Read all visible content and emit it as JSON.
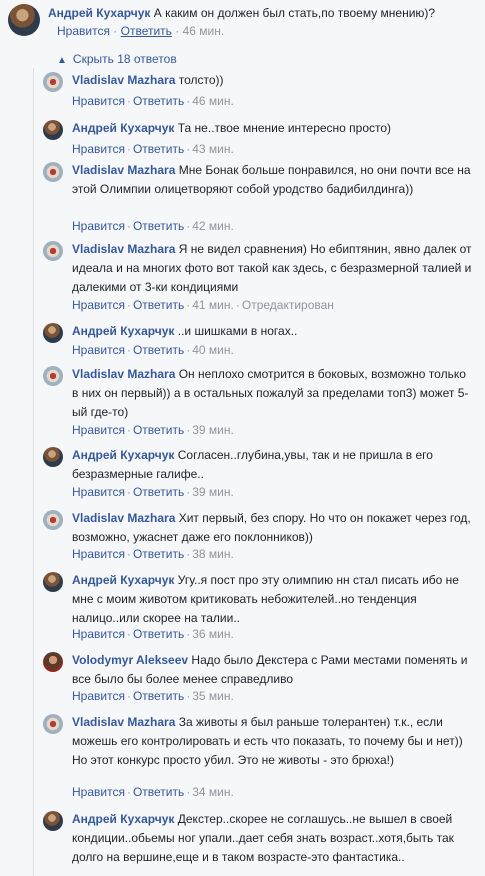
{
  "top": {
    "author": "Андрей Кухарчук",
    "text": "А каким он должен был стать,по твоему мнению)?",
    "like": "Нравится",
    "reply": "Ответить",
    "time": "46 мин."
  },
  "toggle": {
    "label": "Скрыть 18 ответов"
  },
  "replies": [
    {
      "author": "Vladislav Mazhara",
      "text": "толсто))",
      "like": "Нравится",
      "reply": "Ответить",
      "time": "46 мин.",
      "avatar": "vlad"
    },
    {
      "author": "Андрей Кухарчук",
      "text": "Та не..твое мнение интересно просто)",
      "like": "Нравится",
      "reply": "Ответить",
      "time": "43 мин.",
      "avatar": "andrey"
    },
    {
      "author": "Vladislav Mazhara",
      "text": "Мне Бонак больше понравился, но они почти все на этой Олимпии олицетворяют собой уродство бадибилдинга))",
      "like": "Нравится",
      "reply": "Ответить",
      "time": "42 мин.",
      "avatar": "vlad"
    },
    {
      "author": "Vladislav Mazhara",
      "text": "Я не видел сравнения) Но ебиптянин, явно далек от идеала и на многих фото вот такой как здесь, с безразмерной талией и далекими от 3-ки кондициями",
      "like": "Нравится",
      "reply": "Ответить",
      "time": "41 мин.",
      "edited": "Отредактирован",
      "avatar": "vlad"
    },
    {
      "author": "Андрей Кухарчук",
      "text": "..и шишками в ногах..",
      "like": "Нравится",
      "reply": "Ответить",
      "time": "40 мин.",
      "avatar": "andrey"
    },
    {
      "author": "Vladislav Mazhara",
      "text": "Он неплохо смотрится в боковых, возможно только в них он первый)) а в остальных пожалуй за пределами топ3) может 5-ый где-то)",
      "like": "Нравится",
      "reply": "Ответить",
      "time": "39 мин.",
      "avatar": "vlad"
    },
    {
      "author": "Андрей Кухарчук",
      "text": "Согласен..глубина,увы, так и не пришла в его безразмерные галифе..",
      "like": "Нравится",
      "reply": "Ответить",
      "time": "39 мин.",
      "avatar": "andrey"
    },
    {
      "author": "Vladislav Mazhara",
      "text": "Хит первый, без спору. Но что он покажет через год, возможно, ужаснет даже его поклонников))",
      "like": "Нравится",
      "reply": "Ответить",
      "time": "38 мин.",
      "avatar": "vlad"
    },
    {
      "author": "Андрей Кухарчук",
      "text": "Угу..я пост про эту олимпию нн стал писать ибо не мне с моим животом критиковать небожителей..но тенденция налицо..или скорее на талии..",
      "like": "Нравится",
      "reply": "Ответить",
      "time": "36 мин.",
      "avatar": "andrey"
    },
    {
      "author": "Volodymyr Alekseev",
      "text": "Надо было Декстера с Рами местами поменять и все было бы более менее справедливо",
      "like": "Нравится",
      "reply": "Ответить",
      "time": "35 мин.",
      "avatar": "volod"
    },
    {
      "author": "Vladislav Mazhara",
      "text": "За животы я был раньше толерантен) т.к., если можешь его контролировать и есть что показать, то почему бы и нет)) Но этот конкурс просто убил. Это не животы - это брюха!)",
      "like": "Нравится",
      "reply": "Ответить",
      "time": "34 мин.",
      "avatar": "vlad"
    },
    {
      "author": "Андрей Кухарчук",
      "text": "Декстер..скорее не соглашусь..не вышел в своей кондиции..обьемы ног упали..дает себя знать возраст..хотя,быть так долго на вершине,еще и в таком возрасте-это фантастика..",
      "avatar": "andrey"
    }
  ]
}
